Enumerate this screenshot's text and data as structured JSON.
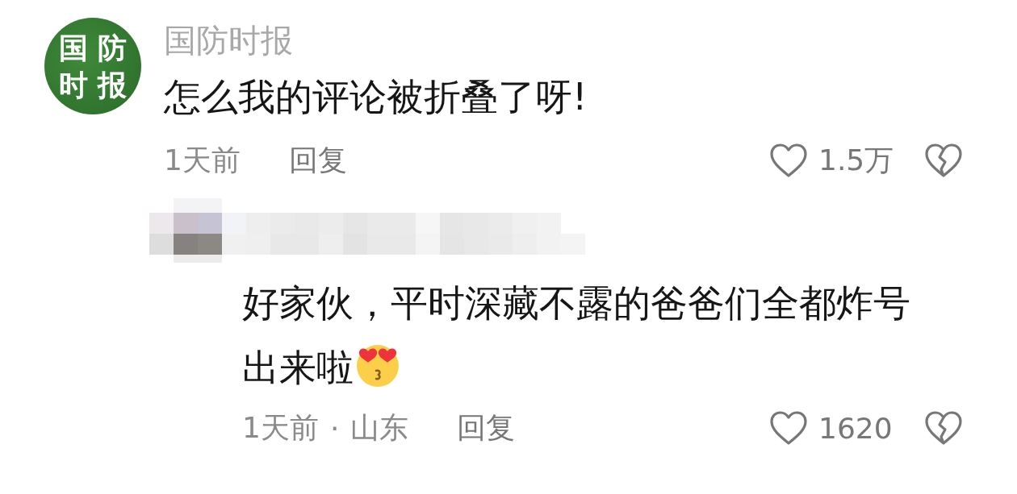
{
  "comment": {
    "avatar": {
      "chars": [
        "国",
        "防",
        "时",
        "报"
      ]
    },
    "author": "国防时报",
    "text": "怎么我的评论被折叠了呀!",
    "time": "1天前",
    "reply_label": "回复",
    "likes": "1.5万"
  },
  "reply": {
    "text_lines": [
      "好家伙，平时深藏不露的爸爸们全都炸号",
      "出来啦"
    ],
    "time": "1天前",
    "location": "山东",
    "separator": "·",
    "reply_label": "回复",
    "likes": "1620"
  }
}
